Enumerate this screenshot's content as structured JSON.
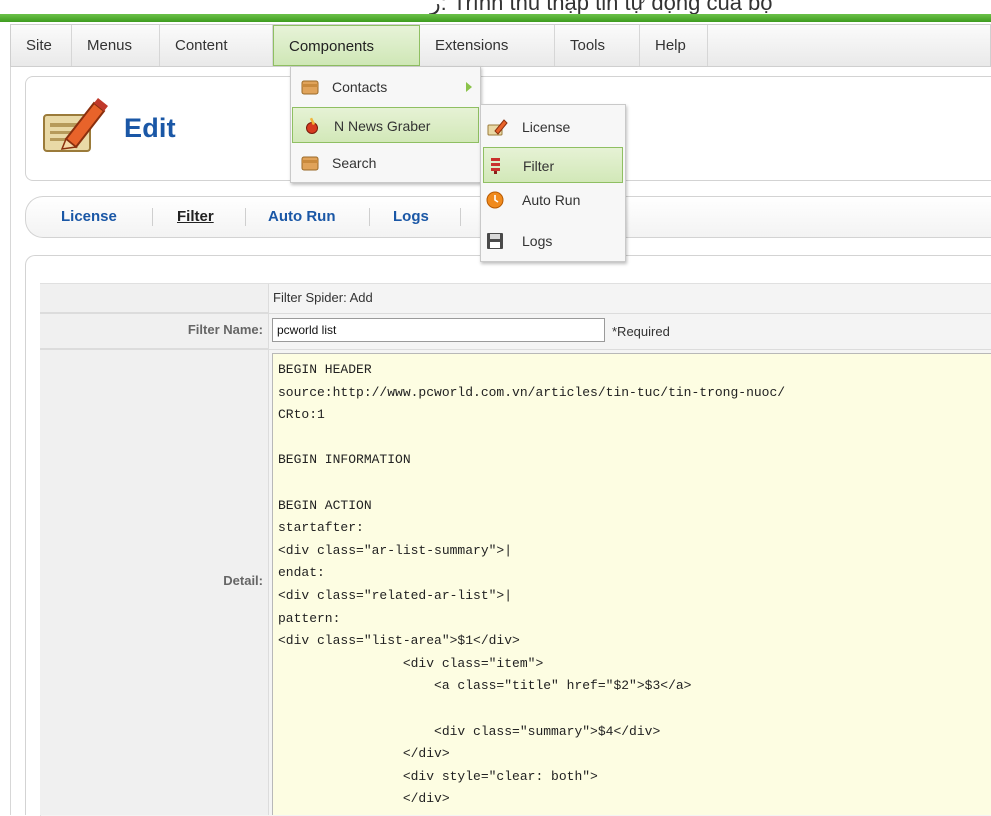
{
  "top_cut_text": "ر: Trình thu thập tin tự động của bộ",
  "menubar": {
    "items": [
      {
        "label": "Site"
      },
      {
        "label": "Menus"
      },
      {
        "label": "Content"
      },
      {
        "label": "Components"
      },
      {
        "label": "Extensions"
      },
      {
        "label": "Tools"
      },
      {
        "label": "Help"
      }
    ]
  },
  "components_menu": {
    "items": [
      {
        "label": "Contacts",
        "icon": "folder-icon",
        "has_submenu": true
      },
      {
        "label": "N News Graber",
        "icon": "news-graber-icon"
      },
      {
        "label": "Search",
        "icon": "folder-icon"
      }
    ]
  },
  "graber_menu": {
    "items": [
      {
        "label": "License",
        "icon": "edit-icon"
      },
      {
        "label": "Filter",
        "icon": "filter-icon"
      },
      {
        "label": "Auto Run",
        "icon": "clock-icon"
      },
      {
        "label": "Logs",
        "icon": "save-icon"
      }
    ]
  },
  "page": {
    "title": "Edit"
  },
  "submenu": {
    "links": [
      "License",
      "Filter",
      "Auto Run",
      "Logs"
    ]
  },
  "form": {
    "heading": "Filter Spider: Add",
    "filter_name_label": "Filter Name:",
    "filter_name_value": "pcworld list",
    "required_text": "*Required",
    "detail_label": "Detail:",
    "detail_text": "BEGIN HEADER\nsource:http://www.pcworld.com.vn/articles/tin-tuc/tin-trong-nuoc/\nCRto:1\n\nBEGIN INFORMATION\n\nBEGIN ACTION\nstartafter:\n<div class=\"ar-list-summary\">|\nendat:\n<div class=\"related-ar-list\">|\npattern:\n<div class=\"list-area\">$1</div>\n                <div class=\"item\">\n                    <a class=\"title\" href=\"$2\">$3</a>\n\n                    <div class=\"summary\">$4</div>\n                </div>\n                <div style=\"clear: both\">\n                </div>\n            </div>|"
  },
  "colors": {
    "accent_green": "#6cc24a",
    "title_blue": "#1a57a6",
    "detail_bg": "#fdfde2"
  }
}
